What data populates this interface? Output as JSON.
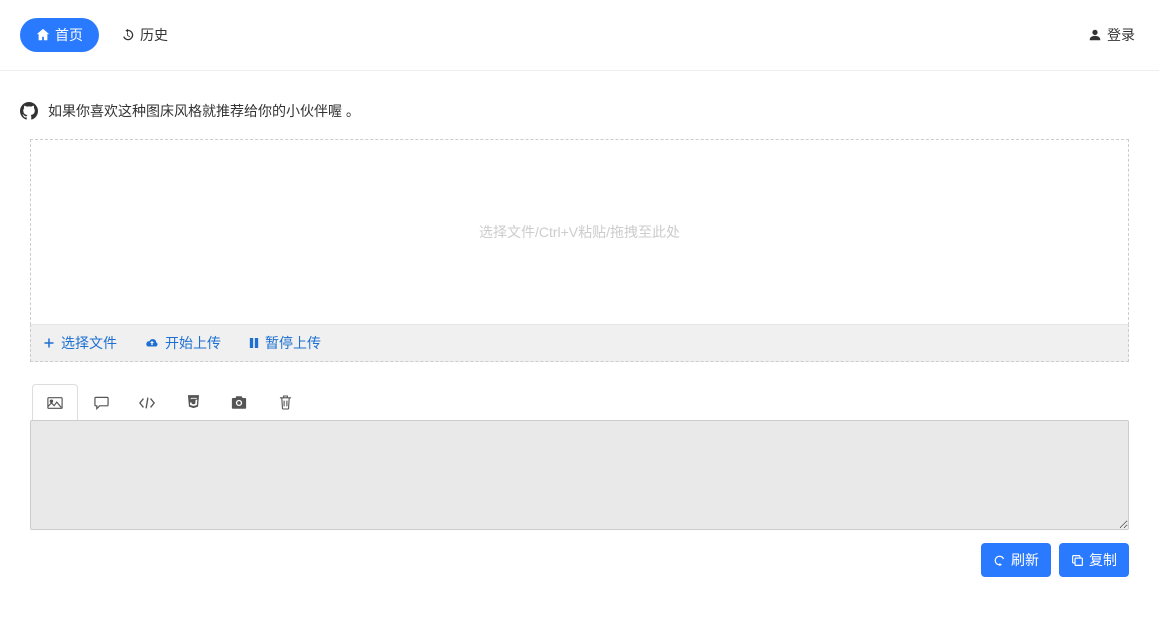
{
  "nav": {
    "home": "首页",
    "history": "历史",
    "login": "登录"
  },
  "promo": {
    "text": "如果你喜欢这种图床风格就推荐给你的小伙伴喔 。"
  },
  "dropzone": {
    "placeholder": "选择文件/Ctrl+V粘贴/拖拽至此处"
  },
  "uploadBar": {
    "select": "选择文件",
    "start": "开始上传",
    "pause": "暂停上传"
  },
  "tabs": {
    "image": "image-icon",
    "comment": "comment-icon",
    "code": "code-icon",
    "html5": "html5-icon",
    "camera": "camera-icon",
    "trash": "trash-icon"
  },
  "result": {
    "value": ""
  },
  "actions": {
    "refresh": "刷新",
    "copy": "复制"
  }
}
